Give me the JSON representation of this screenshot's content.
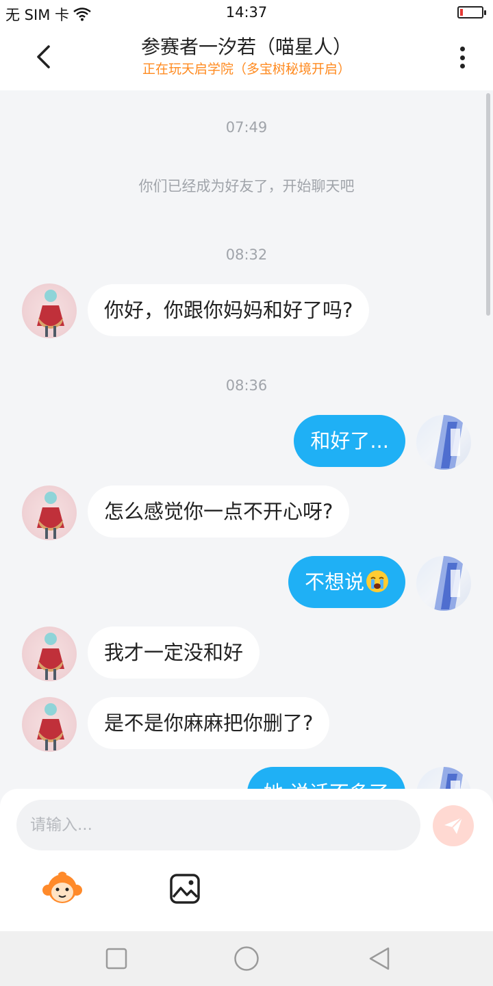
{
  "status_bar": {
    "carrier": "无 SIM 卡",
    "time": "14:37"
  },
  "header": {
    "title": "参赛者一汐若（喵星人）",
    "subtitle": "正在玩天启学院（多宝树秘境开启）"
  },
  "chat": {
    "ts1": "07:49",
    "system_message": "你们已经成为好友了，开始聊天吧",
    "ts2": "08:32",
    "msg1": "你好，你跟你妈妈和好了吗?",
    "ts3": "08:36",
    "msg2": "和好了...",
    "msg3": "怎么感觉你一点不开心呀?",
    "msg4": "不想说",
    "msg5": "我才一定没和好",
    "msg6": "是不是你麻麻把你删了?",
    "msg7": "她 说话不多了"
  },
  "input": {
    "placeholder": "请输入..."
  },
  "colors": {
    "accent": "#1fb0f5",
    "subtitle": "#ff8a1f",
    "send_inactive": "#ffd9d2"
  },
  "icons": {
    "back": "chevron-left-icon",
    "more": "more-vertical-icon",
    "send": "paper-plane-icon",
    "emoji": "monkey-emoji-icon",
    "image": "image-icon",
    "nav_recent": "square-icon",
    "nav_home": "circle-icon",
    "nav_back": "triangle-icon"
  }
}
